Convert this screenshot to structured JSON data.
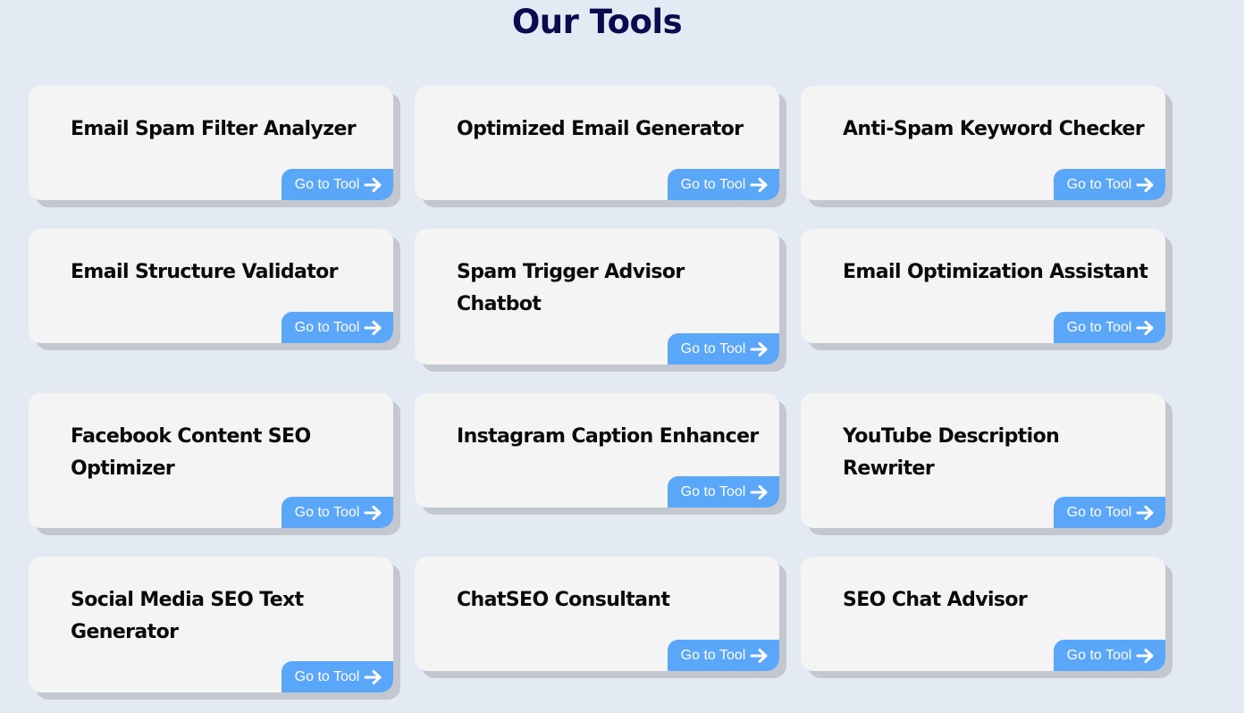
{
  "header": {
    "title": "Our Tools"
  },
  "tools": [
    {
      "name": "Email Spam Filter Analyzer",
      "button_label": "Go to Tool"
    },
    {
      "name": "Optimized Email Generator",
      "button_label": "Go to Tool"
    },
    {
      "name": "Anti-Spam Keyword Checker",
      "button_label": "Go to Tool"
    },
    {
      "name": "Email Structure Validator",
      "button_label": "Go to Tool"
    },
    {
      "name": "Spam Trigger Advisor Chatbot",
      "button_label": "Go to Tool"
    },
    {
      "name": "Email Optimization Assistant",
      "button_label": "Go to Tool"
    },
    {
      "name": "Facebook Content SEO Optimizer",
      "button_label": "Go to Tool"
    },
    {
      "name": "Instagram Caption Enhancer",
      "button_label": "Go to Tool"
    },
    {
      "name": "YouTube Description Rewriter",
      "button_label": "Go to Tool"
    },
    {
      "name": "Social Media SEO Text Generator",
      "button_label": "Go to Tool"
    },
    {
      "name": "ChatSEO Consultant",
      "button_label": "Go to Tool"
    },
    {
      "name": "SEO Chat Advisor",
      "button_label": "Go to Tool"
    }
  ],
  "icons": {
    "button_icon": "arrow-right-icon"
  },
  "colors": {
    "background": "#e4eaf4",
    "title": "#0b0a4f",
    "card": "#f4f4f4",
    "card_shadow": "#c3c7d0",
    "button": "#5aa6f8",
    "button_text": "#ffffff"
  }
}
